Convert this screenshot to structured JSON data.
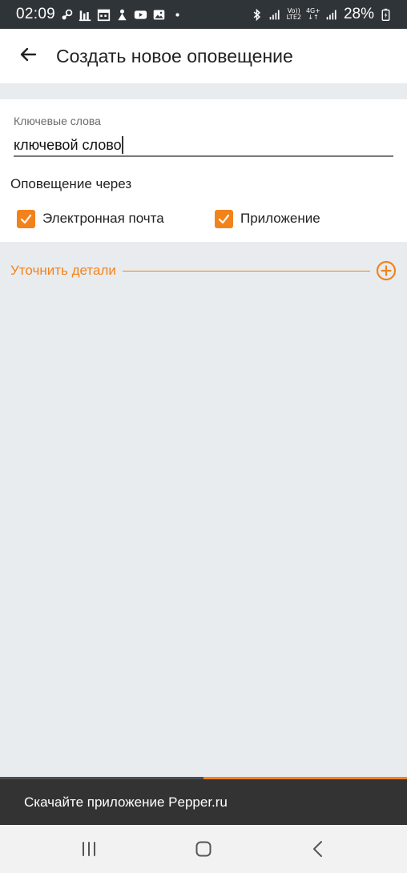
{
  "status_bar": {
    "time": "02:09",
    "network_top": "Vo))",
    "network_bottom": "LTE2",
    "net2_top": "4G+",
    "net2_bottom": "↓↑",
    "battery": "28%"
  },
  "app_bar": {
    "title": "Создать новое оповещение",
    "back_icon": "arrow-left-icon"
  },
  "form": {
    "keywords_label": "Ключевые слова",
    "keywords_value": "ключевой слово",
    "via_label": "Оповещение через",
    "email_label": "Электронная почта",
    "email_checked": true,
    "app_label": "Приложение",
    "app_checked": true
  },
  "details": {
    "label": "Уточнить детали",
    "expand_icon": "plus-circle-icon"
  },
  "snackbar": {
    "text": "Скачайте приложение Pepper.ru",
    "progress": 0.5
  },
  "colors": {
    "accent": "#f2831c",
    "status_bar": "#2f3438",
    "snackbar": "#333333",
    "background": "#e9ecef"
  }
}
